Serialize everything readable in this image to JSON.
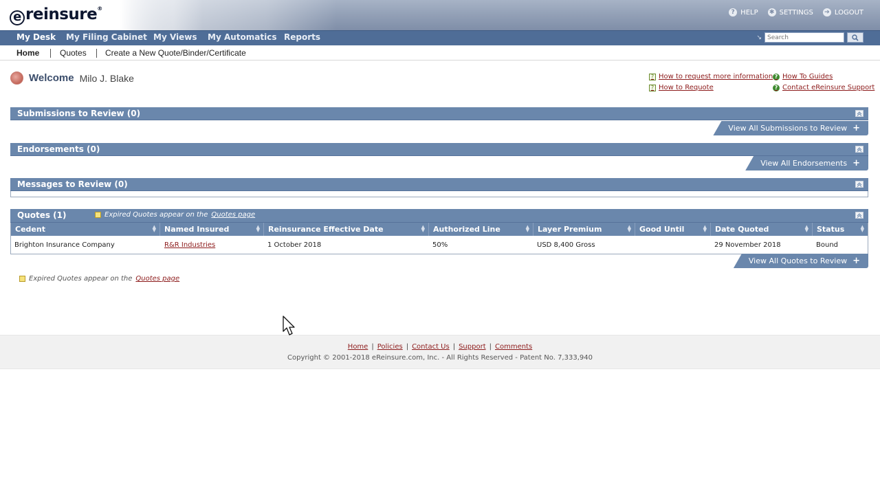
{
  "header": {
    "logo_text": "reinsure",
    "logo_e": "e",
    "logo_mark": "®",
    "links": [
      {
        "label": "HELP",
        "icon": "help-icon"
      },
      {
        "label": "SETTINGS",
        "icon": "gear-icon"
      },
      {
        "label": "LOGOUT",
        "icon": "logout-icon"
      }
    ]
  },
  "mainnav": {
    "items": [
      "My Desk",
      "My Filing Cabinet",
      "My Views",
      "My Automatics",
      "Reports"
    ],
    "search_placeholder": "Search"
  },
  "subnav": {
    "items": [
      "Home",
      "Quotes",
      "Create a New Quote/Binder/Certificate"
    ]
  },
  "welcome": {
    "label": "Welcome",
    "name": "Milo J. Blake"
  },
  "helplinks": {
    "request_info": "How to request more information",
    "requote": "How to Requote",
    "guides": "How To Guides",
    "support": "Contact eReinsure Support"
  },
  "panels": {
    "submissions": {
      "title": "Submissions to Review (0)",
      "view_all": "View All Submissions to Review"
    },
    "endorsements": {
      "title": "Endorsements  (0)",
      "view_all": "View All Endorsements"
    },
    "messages": {
      "title": "Messages to Review (0)"
    },
    "quotes": {
      "title": "Quotes  (1)",
      "note_prefix": "Expired Quotes appear on the",
      "note_link": "Quotes page",
      "view_all": "View All Quotes to Review"
    }
  },
  "quotes_table": {
    "headers": [
      "Cedent",
      "Named Insured",
      "Reinsurance Effective Date",
      "Authorized Line",
      "Layer Premium",
      "Good Until",
      "Date Quoted",
      "Status"
    ],
    "rows": [
      [
        "Brighton Insurance Company",
        "R&R Industries",
        "1 October 2018",
        "50%",
        "USD 8,400 Gross",
        "",
        "29 November 2018",
        "Bound"
      ]
    ]
  },
  "below_note": {
    "prefix": "Expired Quotes appear on the",
    "link": "Quotes page"
  },
  "footer": {
    "links": [
      "Home",
      "Policies",
      "Contact Us",
      "Support",
      "Comments"
    ],
    "copyright": "Copyright © 2001-2018 eReinsure.com, Inc. - All Rights Reserved - Patent No. 7,333,940"
  },
  "colors": {
    "nav_bar": "#4f6d97",
    "panel_bar": "#6a87ac",
    "link_red": "#8c1a1a"
  }
}
